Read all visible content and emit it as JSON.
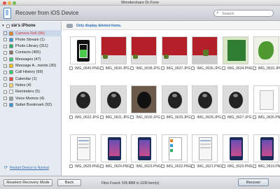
{
  "window": {
    "title": "Wondershare Dr.Fone"
  },
  "header": {
    "title": "Recover from iOS Device",
    "search_placeholder": "Search"
  },
  "sidebar": {
    "device": "xie's iPhone",
    "items": [
      {
        "label": "Camera Roll (96)",
        "selected": true,
        "color": "#e67e22"
      },
      {
        "label": "Photo Stream (1)",
        "selected": false,
        "color": "#3498db"
      },
      {
        "label": "Photo Library (311)",
        "selected": false,
        "color": "#27ae60"
      },
      {
        "label": "Contacts (455)",
        "selected": false,
        "color": "#8d6e63"
      },
      {
        "label": "Messages (47)",
        "selected": false,
        "color": "#2ecc71"
      },
      {
        "label": "Message A...ments (30)",
        "selected": false,
        "color": "#f1c40f"
      },
      {
        "label": "Call History (69)",
        "selected": false,
        "color": "#2ecc71"
      },
      {
        "label": "Calendar (1)",
        "selected": false,
        "color": "#e74c3c"
      },
      {
        "label": "Notes (4)",
        "selected": false,
        "color": "#f5d76e"
      },
      {
        "label": "Reminders (5)",
        "selected": false,
        "color": "#ecf0f1"
      },
      {
        "label": "Voice Memos (4)",
        "selected": false,
        "color": "#95a5a6"
      },
      {
        "label": "Safari Bookmark (92)",
        "selected": false,
        "color": "#3498db"
      }
    ],
    "restart_link": "Restart Device to Normal"
  },
  "toolbar": {
    "filter_label": "Only display deleted items."
  },
  "grid": {
    "rows": [
      [
        {
          "name": "IMG_0640.PNG",
          "type": "battery"
        },
        {
          "name": "IMG_0639.JPG",
          "type": "red"
        },
        {
          "name": "IMG_0638.JPG",
          "type": "red"
        },
        {
          "name": "IMG_0637.JPG",
          "type": "red"
        },
        {
          "name": "IMG_0636.JPG",
          "type": "redobj"
        },
        {
          "name": "IMG_0634.PNG",
          "type": "green"
        },
        {
          "name": "IMG_0633.JPG",
          "type": "plant"
        }
      ],
      [
        {
          "name": "IMG_0632.JPG",
          "type": "mouse"
        },
        {
          "name": "IMG_0631.JPG",
          "type": "mouse"
        },
        {
          "name": "IMG_0630.JPG",
          "type": "mousedark"
        },
        {
          "name": "IMG_0629.JPG",
          "type": "mouse"
        },
        {
          "name": "IMG_0628.JPG",
          "type": "mouse"
        },
        {
          "name": "IMG_0627.JPG",
          "type": "mouse"
        },
        {
          "name": "IMG_0626.PNG",
          "type": "blank"
        }
      ],
      [
        {
          "name": "IMG_0625.PNG",
          "type": "screen"
        },
        {
          "name": "IMG_0624.PNG",
          "type": "iphone"
        },
        {
          "name": "IMG_0623.PNG",
          "type": "iphone"
        },
        {
          "name": "IMG_0622.PNG",
          "type": "list"
        },
        {
          "name": "IMG_0621.PNG",
          "type": "screen"
        },
        {
          "name": "IMG_0620.PNG",
          "type": "iphone"
        },
        {
          "name": "IMG_0619.PNG",
          "type": "iphone"
        }
      ]
    ]
  },
  "footer": {
    "reselect_label": "Reselect Recovery Mode",
    "back_label": "Back",
    "status": "Files Found: 535.88M in 1108 item(s)",
    "recover_label": "Recover"
  },
  "colors": {
    "accent": "#2b6cb6",
    "selected_bg": "#cbd9ea"
  }
}
